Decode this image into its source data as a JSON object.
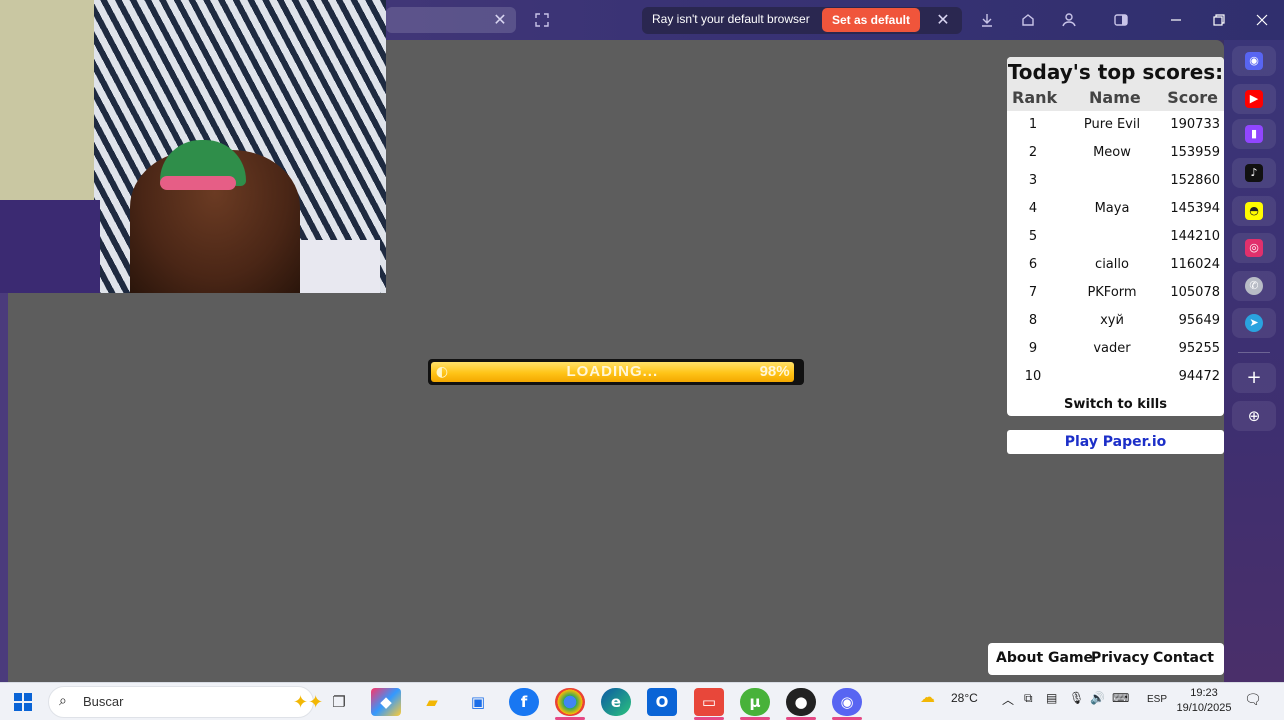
{
  "browser": {
    "default_banner_text": "Ray isn't your default browser",
    "set_default_label": "Set as default",
    "close_glyph": "✕"
  },
  "loading": {
    "label": "LOADING...",
    "percent_text": "98%",
    "progress": 0.98,
    "colors": {
      "fill": "#ffc417",
      "border": "#111111"
    }
  },
  "scoreboard": {
    "title": "Today's top scores:",
    "columns": {
      "rank": "Rank",
      "name": "Name",
      "score": "Score"
    },
    "rows": [
      {
        "rank": "1",
        "name": "Pure Evil",
        "score": "190733"
      },
      {
        "rank": "2",
        "name": "Meow",
        "score": "153959"
      },
      {
        "rank": "3",
        "name": "",
        "score": "152860"
      },
      {
        "rank": "4",
        "name": "Maya",
        "score": "145394"
      },
      {
        "rank": "5",
        "name": "",
        "score": "144210"
      },
      {
        "rank": "6",
        "name": "ciallo",
        "score": "116024"
      },
      {
        "rank": "7",
        "name": "PKForm",
        "score": "105078"
      },
      {
        "rank": "8",
        "name": "хуй",
        "score": "95649"
      },
      {
        "rank": "9",
        "name": "vader",
        "score": "95255"
      },
      {
        "rank": "10",
        "name": "",
        "score": "94472"
      }
    ],
    "switch_label": "Switch to kills",
    "play_label": "Play Paper.io"
  },
  "footer": {
    "about": "About Game",
    "privacy": "Privacy",
    "contact": "Contact"
  },
  "sidebar": {
    "icons": [
      "discord-icon",
      "youtube-icon",
      "twitch-icon",
      "tiktok-icon",
      "snapchat-icon",
      "instagram-icon",
      "whatsapp-icon",
      "telegram-icon",
      "add-icon",
      "globe-icon"
    ]
  },
  "taskbar": {
    "search_placeholder": "Buscar",
    "weather": "28°C",
    "language": "ESP",
    "time": "19:23",
    "date": "19/10/2025"
  }
}
